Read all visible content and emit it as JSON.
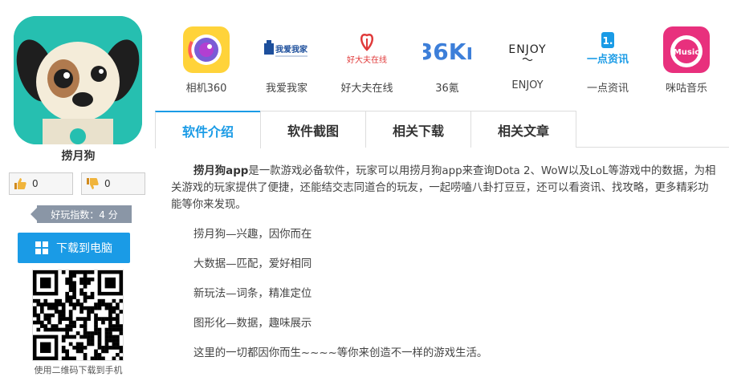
{
  "app": {
    "name": "捞月狗",
    "vote_up": "0",
    "vote_down": "0",
    "score": "好玩指数：4 分",
    "download_label": "下载到电脑",
    "qr_caption": "使用二维码下载到手机"
  },
  "related_apps": [
    {
      "label": "相机360",
      "icon": "camera360-icon"
    },
    {
      "label": "我爱我家",
      "icon": "woaiwojia-icon",
      "logo_text": "我爱我家"
    },
    {
      "label": "好大夫在线",
      "icon": "haodf-icon",
      "logo_text": "好大夫在线"
    },
    {
      "label": "36氪",
      "icon": "36kr-icon",
      "logo_text": "36Kr"
    },
    {
      "label": "ENJOY",
      "icon": "enjoy-icon",
      "logo_text": "ENJOY"
    },
    {
      "label": "一点资讯",
      "icon": "yidian-icon",
      "logo_text": "一点资讯"
    },
    {
      "label": "咪咕音乐",
      "icon": "migu-music-icon",
      "logo_text": "Music"
    }
  ],
  "tabs": [
    "软件介绍",
    "软件截图",
    "相关下载",
    "相关文章"
  ],
  "description": {
    "intro_bold": "捞月狗app",
    "intro_rest": "是一款游戏必备软件，玩家可以用捞月狗app来查询Dota 2、WoW以及LoL等游戏中的数据，为相关游戏的玩家提供了便捷，还能结交志同道合的玩友，一起唠嗑八卦打豆豆，还可以看资讯、找攻略，更多精彩功能等你来发现。",
    "lines": [
      "捞月狗—兴趣，因你而在",
      "大数据—匹配，爱好相同",
      "新玩法—词条，精准定位",
      "图形化—数据，趣味展示",
      "这里的一切都因你而生~~~~等你来创造不一样的游戏生活。"
    ]
  },
  "colors": {
    "accent": "#1a9be6",
    "icon_bg": "#26bfb0",
    "score_badge": "#8a96a6"
  }
}
